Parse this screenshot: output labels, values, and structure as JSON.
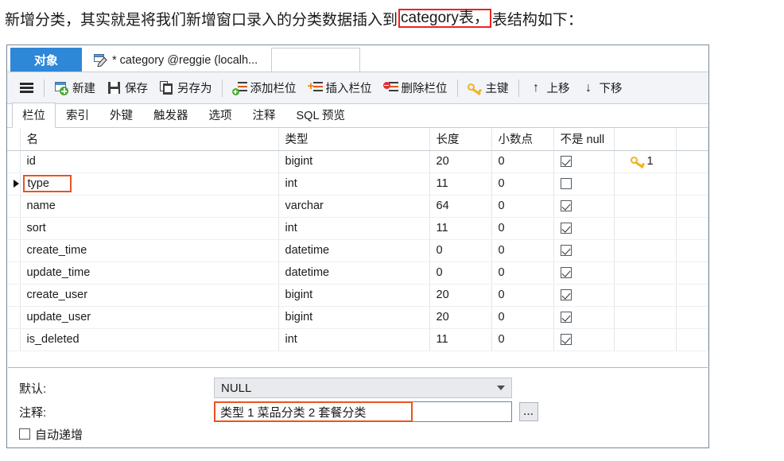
{
  "caption": {
    "before": "新增分类，其实就是将我们新增窗口录入的分类数据插入到",
    "highlight": "category表，",
    "after": "表结构如下："
  },
  "window": {
    "object_tab": "对象",
    "document_tab": "* category @reggie (localh...",
    "document_tab_icon": "table-edit-icon"
  },
  "toolbar": {
    "menu_label": "",
    "items": [
      {
        "label": "新建",
        "icon": "new-table-icon"
      },
      {
        "label": "保存",
        "icon": "save-icon"
      },
      {
        "label": "另存为",
        "icon": "save-as-icon"
      },
      {
        "label": "添加栏位",
        "icon": "add-field-icon"
      },
      {
        "label": "插入栏位",
        "icon": "insert-field-icon"
      },
      {
        "label": "删除栏位",
        "icon": "delete-field-icon"
      },
      {
        "label": "主键",
        "icon": "primary-key-icon"
      },
      {
        "label": "上移",
        "icon": "arrow-up-icon"
      },
      {
        "label": "下移",
        "icon": "arrow-down-icon"
      }
    ]
  },
  "sub_tabs": [
    {
      "label": "栏位",
      "active": true
    },
    {
      "label": "索引",
      "active": false
    },
    {
      "label": "外键",
      "active": false
    },
    {
      "label": "触发器",
      "active": false
    },
    {
      "label": "选项",
      "active": false
    },
    {
      "label": "注释",
      "active": false
    },
    {
      "label": "SQL 预览",
      "active": false
    }
  ],
  "grid": {
    "columns": [
      "名",
      "类型",
      "长度",
      "小数点",
      "不是 null",
      ""
    ],
    "rows": [
      {
        "selected": false,
        "name": "id",
        "type": "bigint",
        "length": "20",
        "decimals": "0",
        "not_null": true,
        "key": "1"
      },
      {
        "selected": true,
        "name": "type",
        "type": "int",
        "length": "11",
        "decimals": "0",
        "not_null": false,
        "key": ""
      },
      {
        "selected": false,
        "name": "name",
        "type": "varchar",
        "length": "64",
        "decimals": "0",
        "not_null": true,
        "key": ""
      },
      {
        "selected": false,
        "name": "sort",
        "type": "int",
        "length": "11",
        "decimals": "0",
        "not_null": true,
        "key": ""
      },
      {
        "selected": false,
        "name": "create_time",
        "type": "datetime",
        "length": "0",
        "decimals": "0",
        "not_null": true,
        "key": ""
      },
      {
        "selected": false,
        "name": "update_time",
        "type": "datetime",
        "length": "0",
        "decimals": "0",
        "not_null": true,
        "key": ""
      },
      {
        "selected": false,
        "name": "create_user",
        "type": "bigint",
        "length": "20",
        "decimals": "0",
        "not_null": true,
        "key": ""
      },
      {
        "selected": false,
        "name": "update_user",
        "type": "bigint",
        "length": "20",
        "decimals": "0",
        "not_null": true,
        "key": ""
      },
      {
        "selected": false,
        "name": "is_deleted",
        "type": "int",
        "length": "11",
        "decimals": "0",
        "not_null": true,
        "key": ""
      }
    ]
  },
  "props": {
    "default_label": "默认:",
    "default_value": "NULL",
    "comment_label": "注释:",
    "comment_value": "类型  1 菜品分类 2 套餐分类",
    "browse_button": "...",
    "auto_increment_label": "自动递增",
    "auto_increment_checked": false
  },
  "colors": {
    "accent_blue": "#2f87d8",
    "highlight_red": "#ef2222",
    "highlight_orange": "#e8541f",
    "key_gold": "#f0b323"
  }
}
